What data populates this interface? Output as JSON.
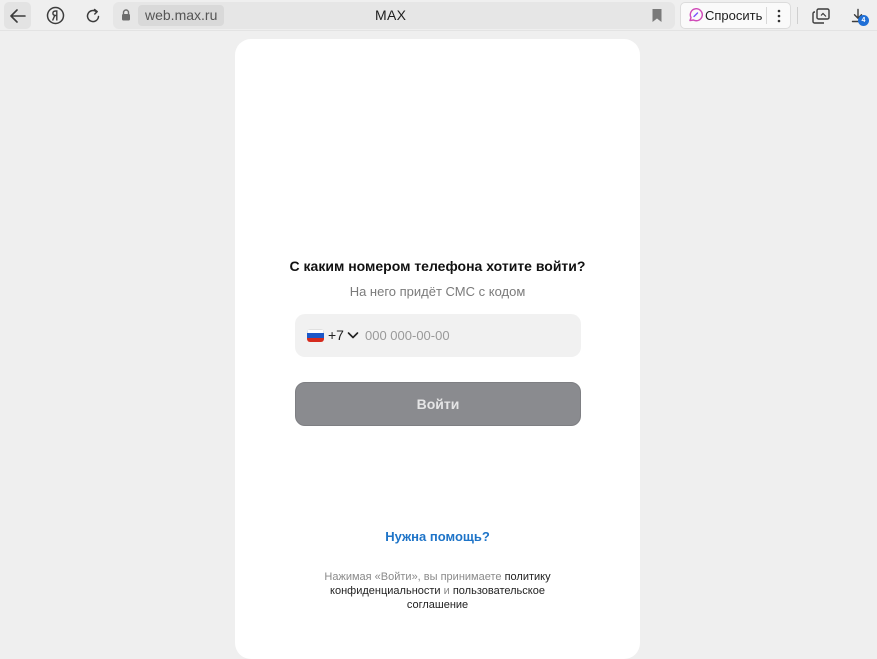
{
  "browser": {
    "address": {
      "url": "web.max.ru",
      "title": "MAX"
    },
    "ask_button_label": "Спросить",
    "downloads_count": "4"
  },
  "login": {
    "heading": "С каким номером телефона хотите войти?",
    "subheading": "На него придёт СМС с кодом",
    "country_code": "+7",
    "phone_placeholder": "000 000-00-00",
    "phone_value": "",
    "submit_label": "Войти",
    "help_link": "Нужна помощь?",
    "legal": {
      "prefix": "Нажимая «Войти», вы принимаете ",
      "privacy_link": "политику конфиденциальности",
      "conjunction": " и ",
      "terms_link": "пользовательское соглашение"
    }
  },
  "colors": {
    "page_bg": "#efefef",
    "card_bg": "#ffffff",
    "button_disabled": "#8a8b8f",
    "link": "#1e74c8"
  }
}
